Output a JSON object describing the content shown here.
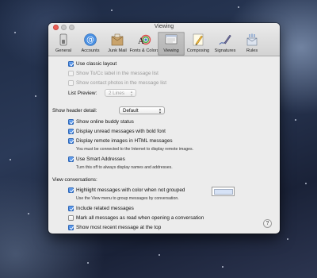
{
  "window": {
    "title": "Viewing"
  },
  "toolbar": {
    "items": [
      {
        "label": "General",
        "icon": "general-switch-icon"
      },
      {
        "label": "Accounts",
        "icon": "at-sign-icon"
      },
      {
        "label": "Junk Mail",
        "icon": "junk-mail-icon"
      },
      {
        "label": "Fonts & Colors",
        "icon": "fonts-colors-icon"
      },
      {
        "label": "Viewing",
        "icon": "viewing-icon"
      },
      {
        "label": "Composing",
        "icon": "pencil-icon"
      },
      {
        "label": "Signatures",
        "icon": "signature-pen-icon"
      },
      {
        "label": "Rules",
        "icon": "rules-icon"
      }
    ],
    "selected": "Viewing"
  },
  "list": {
    "classic_layout": {
      "label": "Use classic layout",
      "checked": true
    },
    "show_to_cc": {
      "label": "Show To/Cc label in the message list",
      "checked": false
    },
    "show_contact_photos": {
      "label": "Show contact photos in the message list",
      "checked": false
    },
    "preview_label": "List Preview:",
    "preview_value": "2 Lines"
  },
  "header": {
    "detail_label": "Show header detail:",
    "detail_value": "Default",
    "online_buddy": {
      "label": "Show online buddy status",
      "checked": true
    },
    "unread_bold": {
      "label": "Display unread messages with bold font",
      "checked": true
    },
    "remote_images": {
      "label": "Display remote images in HTML messages",
      "checked": true
    },
    "remote_images_note": "You must be connected to the Internet to display remote images.",
    "smart_addresses": {
      "label": "Use Smart Addresses",
      "checked": true
    },
    "smart_addresses_note": "Turn this off to always display names and addresses."
  },
  "conversations": {
    "heading": "View conversations:",
    "highlight": {
      "label": "Highlight messages with color when not grouped",
      "checked": true
    },
    "highlight_note": "Use the View menu to group messages by conversation.",
    "highlight_color": "#d6e2f6",
    "include_related": {
      "label": "Include related messages",
      "checked": true
    },
    "mark_all_read": {
      "label": "Mark all messages as read when opening a conversation",
      "checked": false
    },
    "most_recent_top": {
      "label": "Show most recent message at the top",
      "checked": true
    }
  },
  "help": {
    "label": "?"
  },
  "colors": {
    "checkbox_checked": "#2f78de",
    "window_bg": "#ececec"
  }
}
